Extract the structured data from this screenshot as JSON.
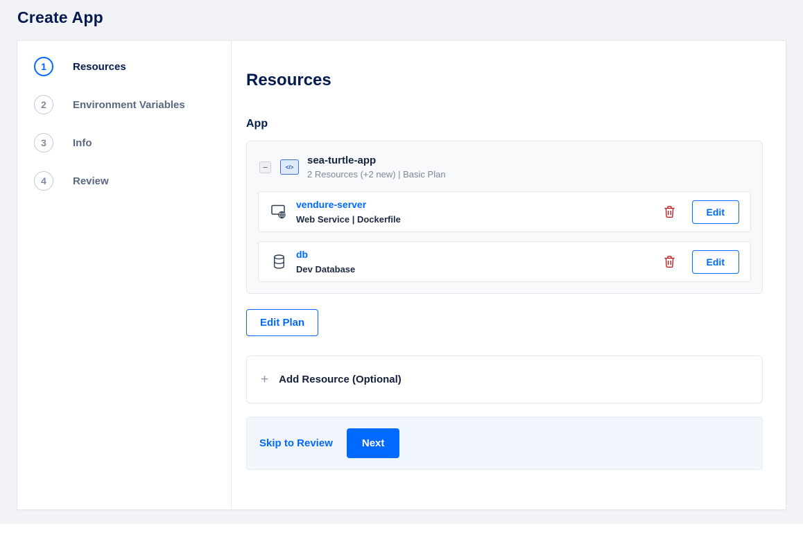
{
  "page": {
    "title": "Create App"
  },
  "stepper": {
    "steps": [
      {
        "number": "1",
        "label": "Resources",
        "active": true
      },
      {
        "number": "2",
        "label": "Environment Variables",
        "active": false
      },
      {
        "number": "3",
        "label": "Info",
        "active": false
      },
      {
        "number": "4",
        "label": "Review",
        "active": false
      }
    ]
  },
  "content": {
    "heading": "Resources",
    "section_label": "App",
    "app_group": {
      "name": "sea-turtle-app",
      "meta": "2 Resources (+2 new) | Basic Plan"
    },
    "resources": [
      {
        "name": "vendure-server",
        "meta": "Web Service | Dockerfile",
        "icon": "web-service-icon",
        "edit_label": "Edit"
      },
      {
        "name": "db",
        "meta": "Dev Database",
        "icon": "database-icon",
        "edit_label": "Edit"
      }
    ],
    "edit_plan_label": "Edit Plan",
    "add_resource_label": "Add Resource (Optional)",
    "footer": {
      "skip_label": "Skip to Review",
      "next_label": "Next"
    }
  },
  "icons": {
    "minus": "−",
    "app_code": "</>",
    "plus": "+"
  },
  "colors": {
    "accent": "#0069ff",
    "heading": "#031b4e",
    "danger": "#c11c1c",
    "page_bg": "#f1f3f6",
    "footer_bg": "#f0f6fc"
  }
}
